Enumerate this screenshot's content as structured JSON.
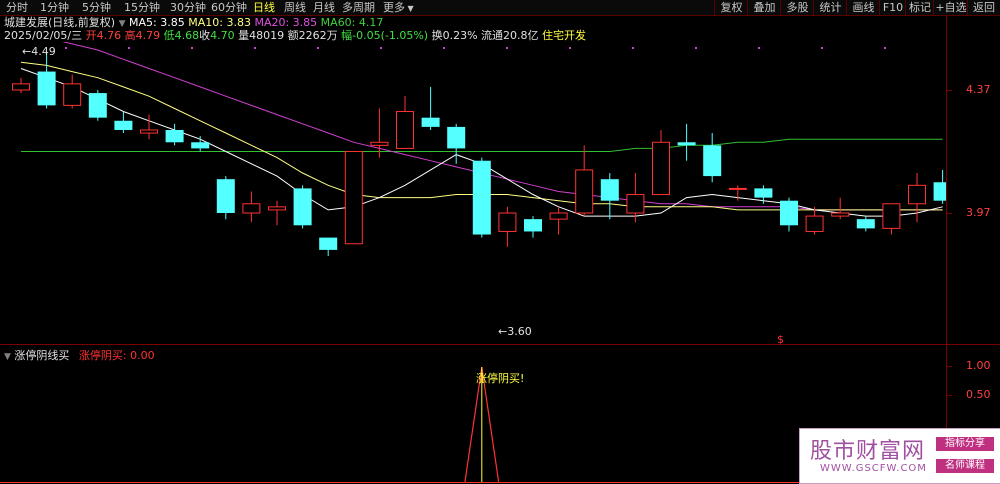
{
  "toolbar": {
    "tabs": [
      "分时",
      "1分钟",
      "5分钟",
      "15分钟",
      "30分钟",
      "60分钟",
      "日线",
      "周线",
      "月线",
      "多周期",
      "更多"
    ],
    "active_tab": "日线",
    "right_buttons": [
      "复权",
      "叠加",
      "多股",
      "统计",
      "画线",
      "F10",
      "标记",
      "+自选",
      "返回"
    ]
  },
  "info": {
    "stock_name": "城建发展(日线,前复权)",
    "ma5": "MA5: 3.85",
    "ma10": "MA10: 3.83",
    "ma20": "MA20: 3.85",
    "ma60": "MA60: 4.17",
    "date": "2025/02/05/三",
    "open_label": "开",
    "open": "4.76",
    "high_label": "高",
    "high": "4.79",
    "low_label": "低",
    "low": "4.68",
    "close_label": "收",
    "close": "4.70",
    "vol_label": "量",
    "vol": "48019",
    "amount_label": "额",
    "amount": "2262万",
    "change_label": "幅",
    "change": "-0.05(-1.05%)",
    "turnover_label": "换",
    "turnover": "0.23%",
    "float_label": "流通",
    "float": "20.8亿",
    "sector": "住宅开发"
  },
  "price_axis": {
    "top": "4.37",
    "bottom": "3.97"
  },
  "annotations": {
    "high_mark": "4.49",
    "low_mark": "3.60",
    "dollar": "$"
  },
  "indicator": {
    "name": "涨停阴线买",
    "signal_label": "涨停阴买:",
    "signal_value": "0.00",
    "signal_text": "涨停阴买!",
    "axis": [
      "1.00",
      "0.50"
    ]
  },
  "watermark": {
    "title": "股市财富网",
    "url": "WWW.GSCFW.COM",
    "badge1": "指标分享",
    "badge2": "名师课程"
  },
  "colors": {
    "up": "#ff3232",
    "down": "#54ffff",
    "ma5": "#ffffff",
    "ma10": "#ffff80",
    "ma20": "#d040d0",
    "ma60": "#30c030"
  },
  "chart_data": {
    "type": "candlestick",
    "candles": [
      {
        "o": 4.37,
        "c": 4.39,
        "h": 4.41,
        "l": 4.36
      },
      {
        "o": 4.43,
        "c": 4.32,
        "h": 4.49,
        "l": 4.31
      },
      {
        "o": 4.32,
        "c": 4.39,
        "h": 4.42,
        "l": 4.31
      },
      {
        "o": 4.36,
        "c": 4.28,
        "h": 4.37,
        "l": 4.27
      },
      {
        "o": 4.27,
        "c": 4.24,
        "h": 4.3,
        "l": 4.23
      },
      {
        "o": 4.23,
        "c": 4.24,
        "h": 4.29,
        "l": 4.21
      },
      {
        "o": 4.24,
        "c": 4.2,
        "h": 4.26,
        "l": 4.19
      },
      {
        "o": 4.2,
        "c": 4.18,
        "h": 4.22,
        "l": 4.17
      },
      {
        "o": 4.08,
        "c": 3.97,
        "h": 4.09,
        "l": 3.95
      },
      {
        "o": 3.97,
        "c": 4.0,
        "h": 4.04,
        "l": 3.94
      },
      {
        "o": 3.98,
        "c": 3.99,
        "h": 4.01,
        "l": 3.93
      },
      {
        "o": 4.05,
        "c": 3.93,
        "h": 4.06,
        "l": 3.92
      },
      {
        "o": 3.89,
        "c": 3.85,
        "h": 3.89,
        "l": 3.83
      },
      {
        "o": 3.87,
        "c": 4.17,
        "h": 4.17,
        "l": 3.87
      },
      {
        "o": 4.19,
        "c": 4.2,
        "h": 4.31,
        "l": 4.15
      },
      {
        "o": 4.18,
        "c": 4.3,
        "h": 4.35,
        "l": 4.18
      },
      {
        "o": 4.28,
        "c": 4.25,
        "h": 4.38,
        "l": 4.24
      },
      {
        "o": 4.25,
        "c": 4.18,
        "h": 4.26,
        "l": 4.13
      },
      {
        "o": 4.14,
        "c": 3.9,
        "h": 4.15,
        "l": 3.89
      },
      {
        "o": 3.91,
        "c": 3.97,
        "h": 3.99,
        "l": 3.86
      },
      {
        "o": 3.95,
        "c": 3.91,
        "h": 3.96,
        "l": 3.89
      },
      {
        "o": 3.95,
        "c": 3.97,
        "h": 3.99,
        "l": 3.9
      },
      {
        "o": 3.97,
        "c": 4.11,
        "h": 4.19,
        "l": 3.96
      },
      {
        "o": 4.08,
        "c": 4.01,
        "h": 4.1,
        "l": 3.95
      },
      {
        "o": 3.97,
        "c": 4.03,
        "h": 4.1,
        "l": 3.94
      },
      {
        "o": 4.03,
        "c": 4.2,
        "h": 4.24,
        "l": 4.03
      },
      {
        "o": 4.2,
        "c": 4.19,
        "h": 4.26,
        "l": 4.14
      },
      {
        "o": 4.19,
        "c": 4.09,
        "h": 4.23,
        "l": 4.07
      },
      {
        "o": 4.05,
        "c": 4.05,
        "h": 4.06,
        "l": 4.01
      },
      {
        "o": 4.05,
        "c": 4.02,
        "h": 4.06,
        "l": 4.0
      },
      {
        "o": 4.01,
        "c": 3.93,
        "h": 4.02,
        "l": 3.91
      },
      {
        "o": 3.91,
        "c": 3.96,
        "h": 3.99,
        "l": 3.9
      },
      {
        "o": 3.96,
        "c": 3.97,
        "h": 4.02,
        "l": 3.95
      },
      {
        "o": 3.95,
        "c": 3.92,
        "h": 3.96,
        "l": 3.91
      },
      {
        "o": 3.92,
        "c": 4.0,
        "h": 4.0,
        "l": 3.9
      },
      {
        "o": 4.0,
        "c": 4.06,
        "h": 4.1,
        "l": 3.94
      },
      {
        "o": 4.07,
        "c": 4.01,
        "h": 4.11,
        "l": 4.0
      }
    ],
    "ma5": [
      4.44,
      4.41,
      4.38,
      4.34,
      4.3,
      4.27,
      4.24,
      4.21,
      4.17,
      4.13,
      4.09,
      4.03,
      3.98,
      3.99,
      4.02,
      4.06,
      4.11,
      4.16,
      4.13,
      4.08,
      4.03,
      3.99,
      3.96,
      3.96,
      3.96,
      3.97,
      4.02,
      4.03,
      4.02,
      4.01,
      4.0,
      3.98,
      3.97,
      3.96,
      3.96,
      3.97,
      3.99
    ],
    "ma10": [
      4.46,
      4.45,
      4.43,
      4.41,
      4.38,
      4.35,
      4.31,
      4.27,
      4.23,
      4.19,
      4.15,
      4.1,
      4.06,
      4.03,
      4.02,
      4.02,
      4.02,
      4.03,
      4.03,
      4.03,
      4.02,
      4.01,
      4.0,
      4.0,
      3.99,
      3.99,
      3.99,
      3.99,
      3.98,
      3.98,
      3.98,
      3.98,
      3.98,
      3.98,
      3.98,
      3.98,
      3.98
    ],
    "ma20": [
      4.56,
      4.54,
      4.52,
      4.5,
      4.47,
      4.44,
      4.41,
      4.38,
      4.35,
      4.32,
      4.29,
      4.26,
      4.23,
      4.2,
      4.18,
      4.16,
      4.14,
      4.12,
      4.1,
      4.08,
      4.06,
      4.04,
      4.03,
      4.02,
      4.01,
      4.0,
      4.0,
      3.99,
      3.99,
      3.99,
      3.99,
      3.98,
      3.98,
      3.98,
      3.98,
      3.98,
      3.98
    ],
    "ma60": [
      4.17,
      4.17,
      4.17,
      4.17,
      4.17,
      4.17,
      4.17,
      4.17,
      4.17,
      4.17,
      4.17,
      4.17,
      4.17,
      4.17,
      4.17,
      4.17,
      4.17,
      4.17,
      4.17,
      4.17,
      4.17,
      4.17,
      4.17,
      4.17,
      4.18,
      4.18,
      4.19,
      4.19,
      4.2,
      4.2,
      4.21,
      4.21,
      4.21,
      4.21,
      4.21,
      4.21,
      4.21
    ],
    "signal": [
      0,
      0,
      0,
      0,
      0,
      0,
      0,
      0,
      0,
      0,
      0,
      0,
      0,
      0,
      0,
      0,
      0,
      0,
      1,
      0,
      0,
      0,
      0,
      0,
      0,
      0,
      0,
      0,
      0,
      0,
      0,
      0,
      0,
      0,
      0,
      0,
      0
    ],
    "signal_index": 18
  }
}
